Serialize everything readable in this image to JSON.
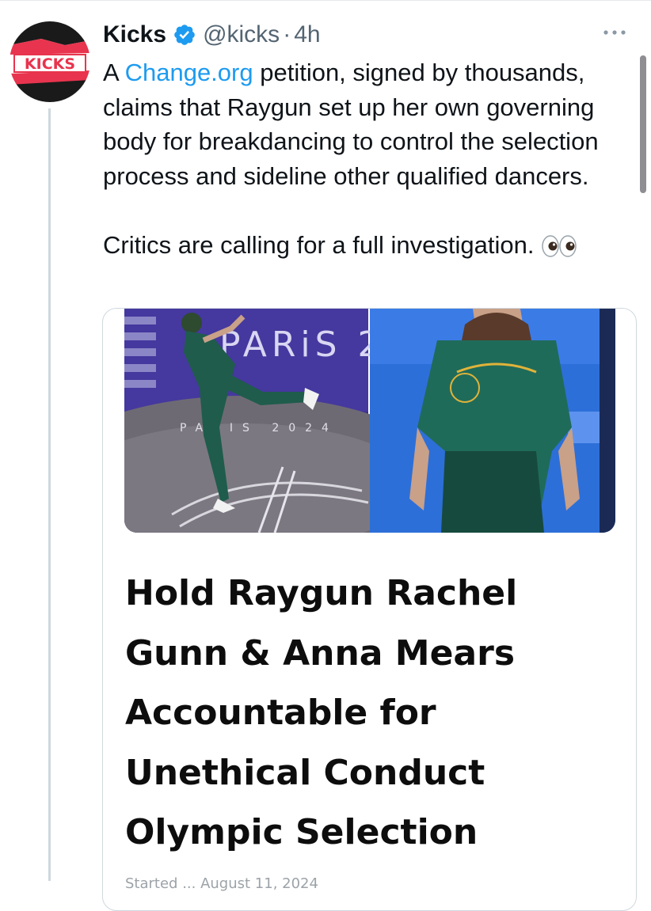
{
  "author": {
    "name": "Kicks",
    "handle": "@kicks",
    "separator": "·",
    "time": "4h",
    "avatar_text": "KICKS",
    "verified": true
  },
  "tweet": {
    "text_prefix": "A ",
    "link_text": "Change.org",
    "text_rest": " petition, signed by thousands, claims that Raygun set up her own governing body for breakdancing to control the selection process and sideline other qualified dancers.",
    "text_second": "Critics are calling for a full investigation.",
    "emoji": "eyes-emoji"
  },
  "card": {
    "headline": "Hold Raygun Rachel Gunn & Anna Mears Accountable for Unethical Conduct Olympic Selection",
    "photo_sign_text": "PARiS 2",
    "floor_text": "PARIS 2024",
    "partial_footer": "Started ... August 11, 2024"
  },
  "icons": {
    "more": "more-horizontal-icon",
    "verified": "verified-badge-icon"
  },
  "colors": {
    "link": "#1d9bf0",
    "verified": "#1d9bf0",
    "secondary_text": "#536471",
    "brand_red": "#e8344e"
  }
}
